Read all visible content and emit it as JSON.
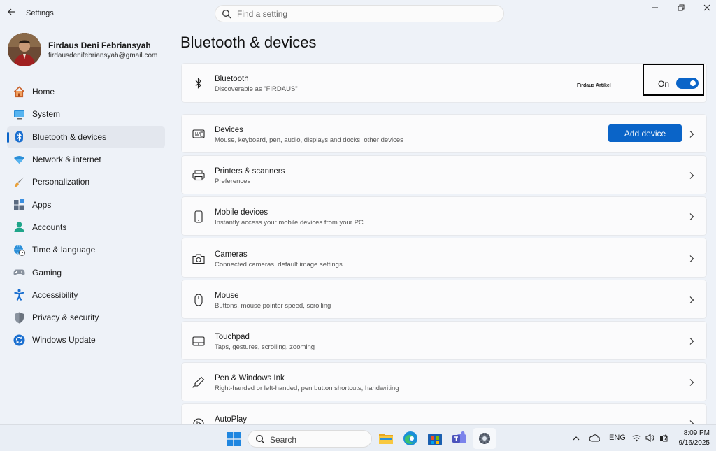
{
  "window": {
    "app_title": "Settings",
    "search_placeholder": "Find a setting"
  },
  "profile": {
    "name": "Firdaus Deni Febriansyah",
    "email": "firdausdenifebriansyah@gmail.com"
  },
  "sidebar": {
    "items": [
      {
        "label": "Home",
        "icon": "home-icon"
      },
      {
        "label": "System",
        "icon": "system-icon"
      },
      {
        "label": "Bluetooth & devices",
        "icon": "bluetooth-icon",
        "active": true
      },
      {
        "label": "Network & internet",
        "icon": "wifi-icon"
      },
      {
        "label": "Personalization",
        "icon": "brush-icon"
      },
      {
        "label": "Apps",
        "icon": "apps-icon"
      },
      {
        "label": "Accounts",
        "icon": "person-icon"
      },
      {
        "label": "Time & language",
        "icon": "globe-clock-icon"
      },
      {
        "label": "Gaming",
        "icon": "gamepad-icon"
      },
      {
        "label": "Accessibility",
        "icon": "accessibility-icon"
      },
      {
        "label": "Privacy & security",
        "icon": "shield-icon"
      },
      {
        "label": "Windows Update",
        "icon": "update-icon"
      }
    ]
  },
  "main": {
    "page_title": "Bluetooth & devices",
    "bluetooth": {
      "title": "Bluetooth",
      "subtitle": "Discoverable as \"FIRDAUS\"",
      "watermark": "Firdaus Artikel",
      "toggle_label": "On",
      "toggle_on": true
    },
    "devices": {
      "title": "Devices",
      "subtitle": "Mouse, keyboard, pen, audio, displays and docks, other devices",
      "button_label": "Add device"
    },
    "rows": [
      {
        "title": "Printers & scanners",
        "subtitle": "Preferences",
        "icon": "printer-icon"
      },
      {
        "title": "Mobile devices",
        "subtitle": "Instantly access your mobile devices from your PC",
        "icon": "phone-icon"
      },
      {
        "title": "Cameras",
        "subtitle": "Connected cameras, default image settings",
        "icon": "camera-icon"
      },
      {
        "title": "Mouse",
        "subtitle": "Buttons, mouse pointer speed, scrolling",
        "icon": "mouse-icon"
      },
      {
        "title": "Touchpad",
        "subtitle": "Taps, gestures, scrolling, zooming",
        "icon": "touchpad-icon"
      },
      {
        "title": "Pen & Windows Ink",
        "subtitle": "Right-handed or left-handed, pen button shortcuts, handwriting",
        "icon": "pen-icon"
      },
      {
        "title": "AutoPlay",
        "subtitle": "",
        "icon": "autoplay-icon"
      }
    ]
  },
  "taskbar": {
    "search_label": "Search",
    "language": "ENG",
    "time": "8:09 PM",
    "date": "9/16/2025"
  },
  "colors": {
    "accent": "#0a64c8",
    "background": "#eef2f8",
    "card": "#fbfbfc"
  }
}
